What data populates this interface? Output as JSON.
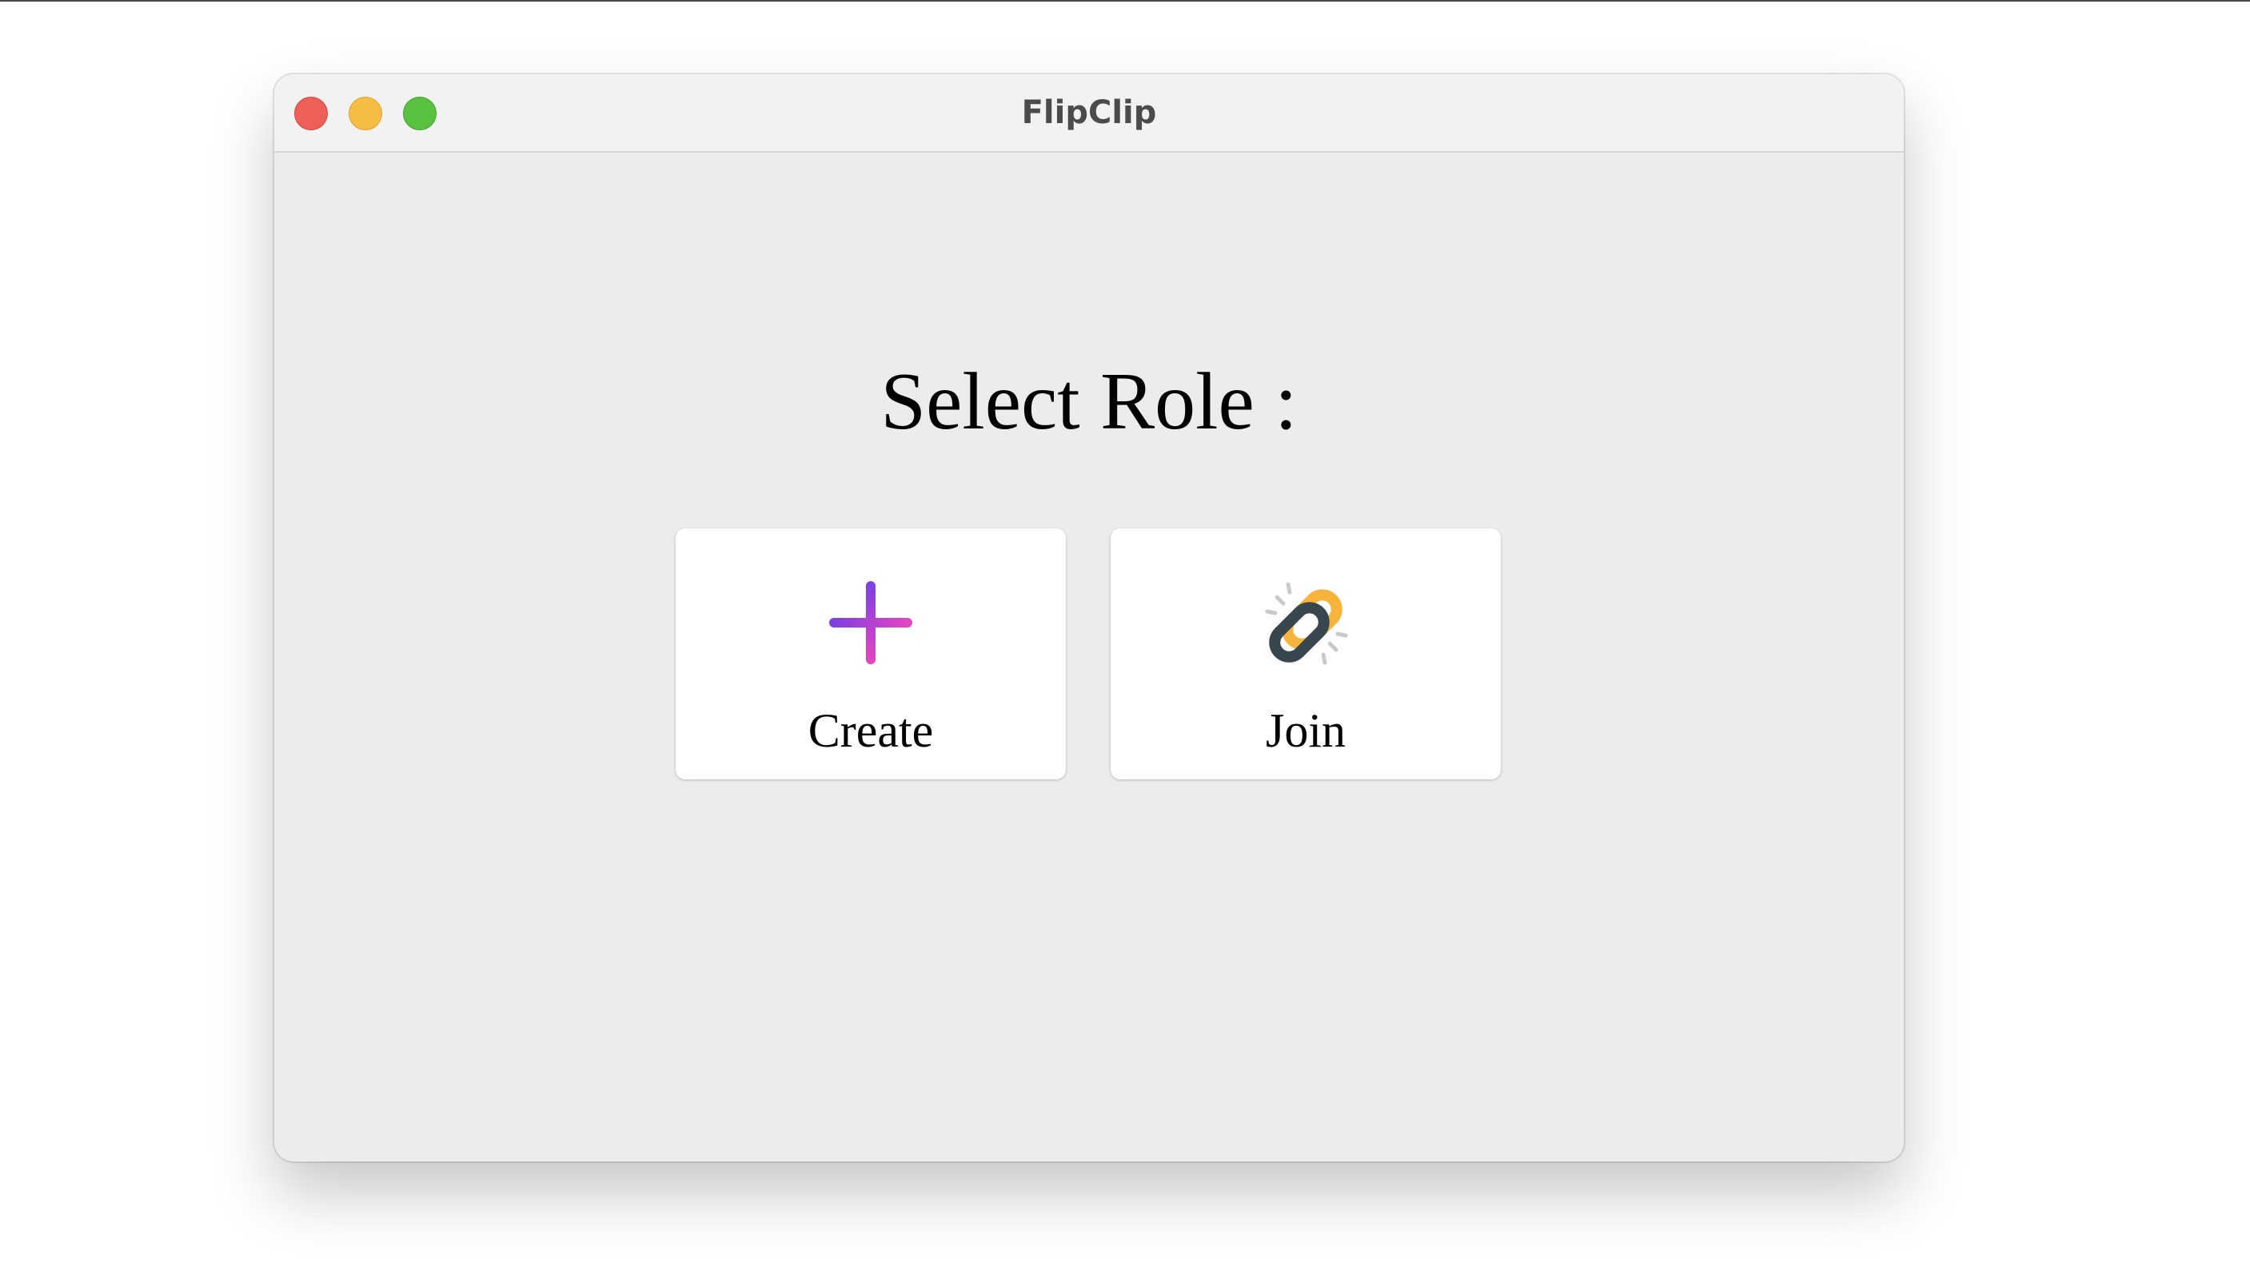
{
  "window": {
    "title": "FlipClip"
  },
  "main": {
    "heading": "Select Role :",
    "roles": [
      {
        "label": "Create",
        "icon": "plus-icon"
      },
      {
        "label": "Join",
        "icon": "chain-link-icon"
      }
    ]
  },
  "colors": {
    "traffic_close": "#ee5f57",
    "traffic_minimize": "#f5bd41",
    "traffic_zoom": "#58c140",
    "plus_gradient_start": "#7b3fe4",
    "plus_gradient_end": "#e845c0",
    "link_gold": "#f6b53a",
    "link_dark": "#37464f"
  }
}
